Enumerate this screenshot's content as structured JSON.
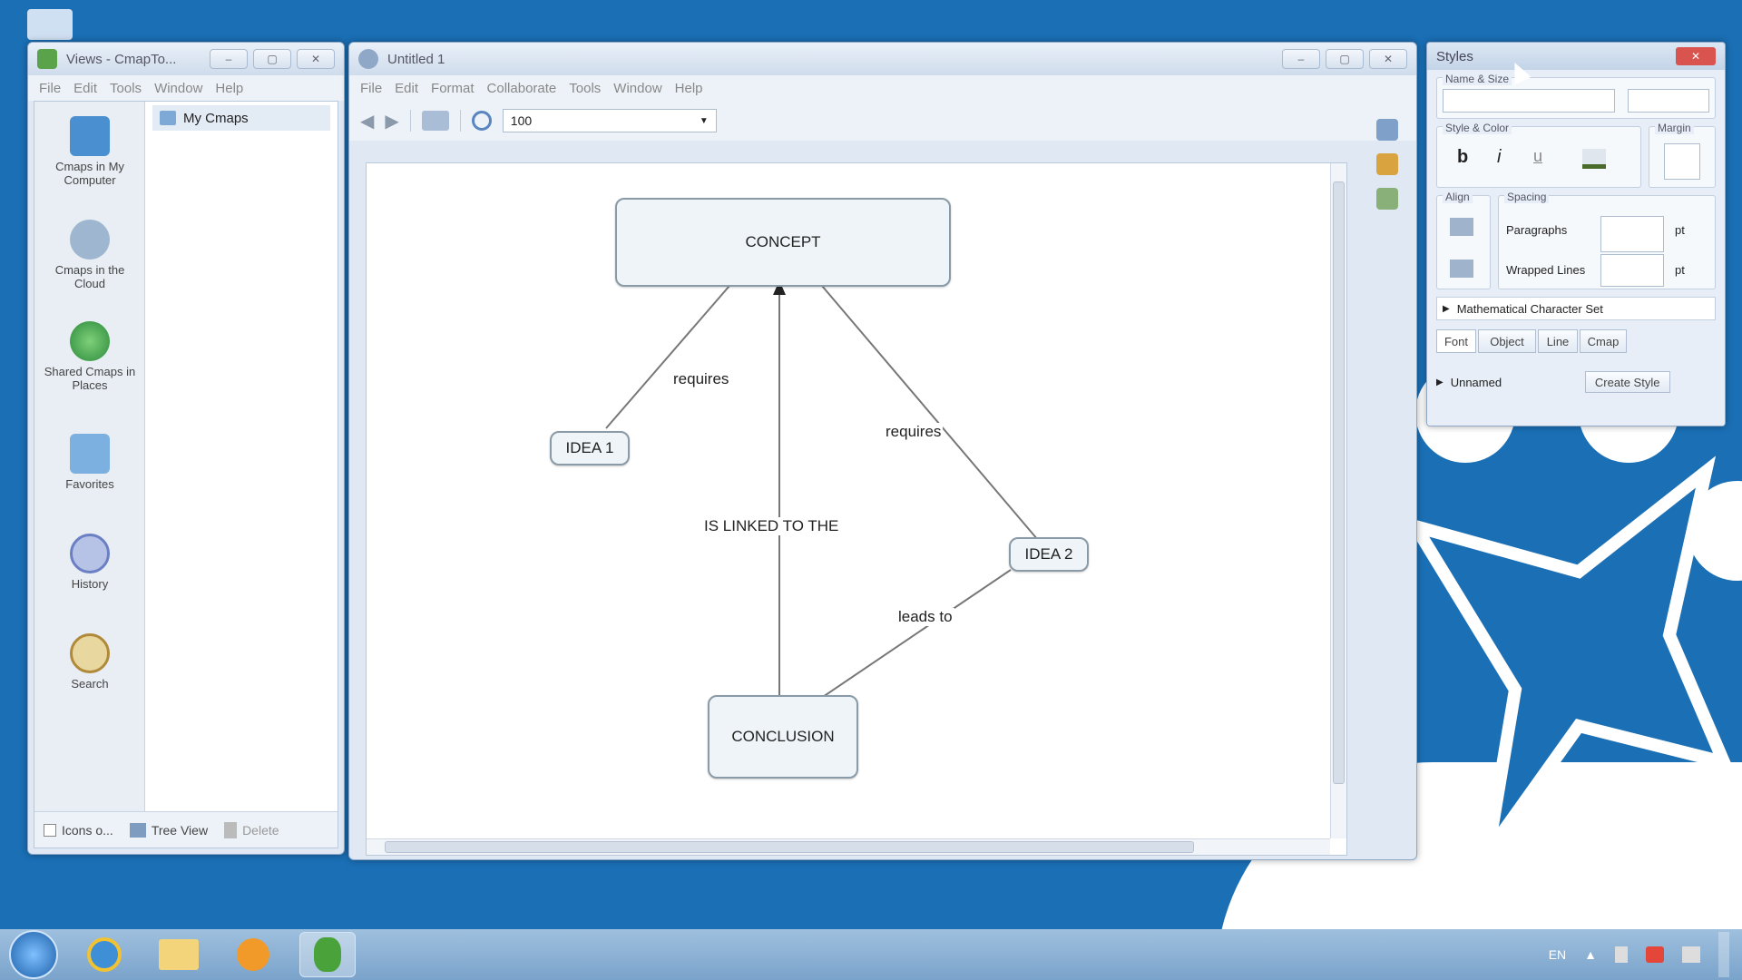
{
  "desktop": {
    "bg": "#1a6fb5"
  },
  "views_window": {
    "title": "Views - CmapTo...",
    "menu": [
      "File",
      "Edit",
      "Tools",
      "Window",
      "Help"
    ],
    "nav": [
      {
        "label": "Cmaps in My Computer",
        "icon": "computer-icon"
      },
      {
        "label": "Cmaps in the Cloud",
        "icon": "cloud-icon"
      },
      {
        "label": "Shared Cmaps in Places",
        "icon": "globe-icon"
      },
      {
        "label": "Favorites",
        "icon": "favorites-icon"
      },
      {
        "label": "History",
        "icon": "history-icon"
      },
      {
        "label": "Search",
        "icon": "search-icon"
      }
    ],
    "list_item": "My Cmaps",
    "footer": {
      "icons_only": "Icons o...",
      "tree_view": "Tree View",
      "delete": "Delete"
    }
  },
  "editor_window": {
    "title": "Untitled 1",
    "menu": [
      "File",
      "Edit",
      "Format",
      "Collaborate",
      "Tools",
      "Window",
      "Help"
    ],
    "zoom": "100",
    "map": {
      "concepts": {
        "concept": "CONCEPT",
        "idea1": "IDEA 1",
        "idea2": "IDEA 2",
        "conclusion": "CONCLUSION"
      },
      "links": {
        "requires_left": "requires",
        "requires_right": "requires",
        "linked": "IS LINKED TO THE",
        "leads": "leads to"
      }
    }
  },
  "styles_window": {
    "title": "Styles",
    "sections": {
      "name_size": "Name & Size",
      "style_color": "Style & Color",
      "margin": "Margin",
      "align": "Align",
      "spacing": "Spacing"
    },
    "bold": "b",
    "italic": "i",
    "underline": "u",
    "paragraphs": "Paragraphs",
    "wrapped_lines": "Wrapped Lines",
    "unit": "pt",
    "math": "Mathematical Character Set",
    "tabs": [
      "Font",
      "Object",
      "Line",
      "Cmap"
    ],
    "style_name": "Unnamed",
    "create_style": "Create Style"
  },
  "taskbar": {
    "tray_lang": "EN"
  }
}
